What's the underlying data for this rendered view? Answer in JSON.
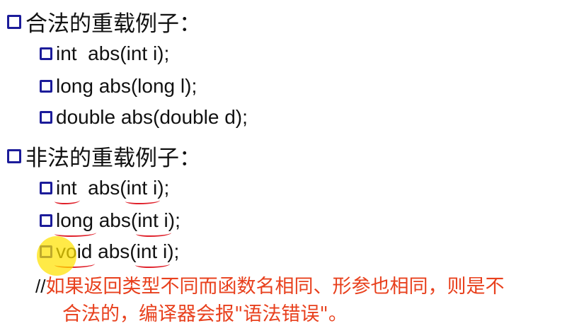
{
  "legal": {
    "heading": "合法的重载例子：",
    "items": [
      "int  abs(int i);",
      "long abs(long l);",
      "double abs(double d);"
    ]
  },
  "illegal": {
    "heading": "非法的重载例子：",
    "items": [
      {
        "ret": "int",
        "sep": "  abs(",
        "params": "int i",
        "end": ");"
      },
      {
        "ret": "long",
        "sep": " abs(",
        "params": "int i",
        "end": ");"
      },
      {
        "ret": "void",
        "sep": " abs(",
        "params": "int i",
        "end": ");"
      }
    ]
  },
  "note": {
    "slashes": "//",
    "line1": "如果返回类型不同而函数名相同、形参也相同，则是不",
    "line2": "合法的，编译器会报\"语法错误\"。"
  },
  "colors": {
    "bullet": "#1c1c9a",
    "annotation": "#e0202a",
    "note_text": "#e8401d",
    "cursor_highlight": "#ffe200"
  }
}
